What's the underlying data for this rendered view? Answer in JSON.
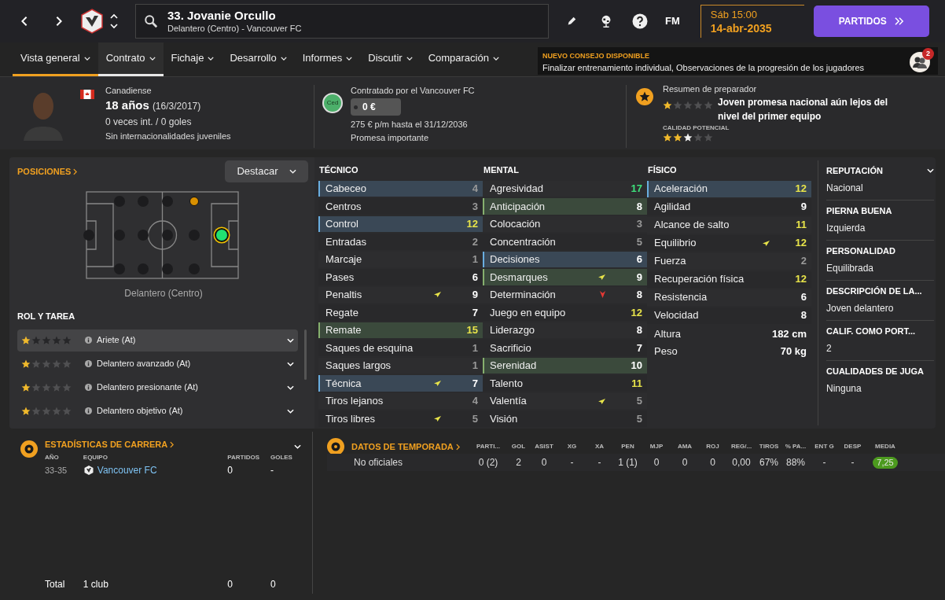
{
  "topbar": {
    "player_title": "33. Jovanie Orcullo",
    "player_subtitle": "Delantero (Centro) - Vancouver FC",
    "fm_label": "FM",
    "day_time": "Sáb 15:00",
    "date": "14-abr-2035",
    "continue_button": "PARTIDOS"
  },
  "tabs": [
    {
      "label": "Vista general",
      "selected": true,
      "hovered": false
    },
    {
      "label": "Contrato",
      "selected": false,
      "hovered": true
    },
    {
      "label": "Fichaje",
      "selected": false,
      "hovered": false
    },
    {
      "label": "Desarrollo",
      "selected": false,
      "hovered": false
    },
    {
      "label": "Informes",
      "selected": false,
      "hovered": false
    },
    {
      "label": "Discutir",
      "selected": false,
      "hovered": false
    },
    {
      "label": "Comparación",
      "selected": false,
      "hovered": false
    }
  ],
  "notification": {
    "title": "NUEVO CONSEJO DISPONIBLE",
    "text": "Finalizar entrenamiento individual, Observaciones de la progresión de los jugadores",
    "badge": "2"
  },
  "header": {
    "nationality": "Canadiense",
    "age": "18 años",
    "birth": "(16/3/2017)",
    "caps": "0 veces int. / 0 goles",
    "youth": "Sin internacionalidades juveniles",
    "contract_badge": "Ced",
    "contract_title": "Contratado por el Vancouver FC",
    "wage": "0 €",
    "wage_terms": "275 € p/m hasta el 31/12/2036",
    "status": "Promesa importante",
    "coach_title": "Resumen de preparador",
    "current": {
      "stars": 1
    },
    "coach_summary": "Joven promesa nacional aún lejos del nivel del primer equipo",
    "potential": {
      "label": "CALIDAD POTENCIAL",
      "stars": 2,
      "uncertain_next": true
    }
  },
  "positions": {
    "title": "POSICIONES",
    "highlight_button": "Destacar",
    "pitch": [
      [
        {
          "kind": "empty"
        }
      ],
      [
        {
          "kind": "empty"
        },
        {
          "kind": "empty"
        },
        {
          "kind": "empty"
        }
      ],
      [
        {
          "kind": "empty"
        },
        {
          "kind": "empty"
        },
        {
          "kind": "empty"
        }
      ],
      [
        {
          "kind": "empty"
        },
        {
          "kind": "empty"
        },
        {
          "kind": "empty"
        }
      ],
      [
        {
          "kind": "competent"
        },
        {
          "kind": "empty"
        },
        {
          "kind": "empty"
        }
      ],
      [
        {
          "kind": "natural"
        }
      ]
    ],
    "position_label": "Delantero (Centro)"
  },
  "roles": {
    "title": "ROL Y TAREA",
    "items": [
      {
        "name": "Ariete (At)",
        "stars": 1,
        "selected": true
      },
      {
        "name": "Delantero avanzado (At)",
        "stars": 1,
        "selected": false
      },
      {
        "name": "Delantero presionante (At)",
        "stars": 1,
        "selected": false
      },
      {
        "name": "Delantero objetivo (At)",
        "stars": 1,
        "selected": false
      }
    ]
  },
  "attributes": [
    {
      "title": "TÉCNICO",
      "items": [
        {
          "name": "Cabeceo",
          "value": "4",
          "kind": "key",
          "rising": false,
          "falling": false
        },
        {
          "name": "Centros",
          "value": "3",
          "kind": "plain",
          "rising": false,
          "falling": false
        },
        {
          "name": "Control",
          "value": "12",
          "kind": "key",
          "rising": false,
          "falling": false
        },
        {
          "name": "Entradas",
          "value": "2",
          "kind": "plain",
          "rising": false,
          "falling": false
        },
        {
          "name": "Marcaje",
          "value": "1",
          "kind": "plain",
          "rising": false,
          "falling": false
        },
        {
          "name": "Pases",
          "value": "6",
          "kind": "plain",
          "rising": false,
          "falling": false
        },
        {
          "name": "Penaltis",
          "value": "9",
          "kind": "plain",
          "rising": true,
          "falling": false
        },
        {
          "name": "Regate",
          "value": "7",
          "kind": "plain",
          "rising": false,
          "falling": false
        },
        {
          "name": "Remate",
          "value": "15",
          "kind": "preferred",
          "rising": false,
          "falling": false
        },
        {
          "name": "Saques de esquina",
          "value": "1",
          "kind": "plain",
          "rising": false,
          "falling": false
        },
        {
          "name": "Saques largos",
          "value": "1",
          "kind": "plain",
          "rising": false,
          "falling": false
        },
        {
          "name": "Técnica",
          "value": "7",
          "kind": "key",
          "rising": true,
          "falling": false
        },
        {
          "name": "Tiros lejanos",
          "value": "4",
          "kind": "plain",
          "rising": false,
          "falling": false
        },
        {
          "name": "Tiros libres",
          "value": "5",
          "kind": "plain",
          "rising": true,
          "falling": false
        }
      ]
    },
    {
      "title": "MENTAL",
      "items": [
        {
          "name": "Agresividad",
          "value": "17",
          "kind": "plain",
          "rising": false,
          "falling": false
        },
        {
          "name": "Anticipación",
          "value": "8",
          "kind": "preferred",
          "rising": false,
          "falling": false
        },
        {
          "name": "Colocación",
          "value": "3",
          "kind": "plain",
          "rising": false,
          "falling": false
        },
        {
          "name": "Concentración",
          "value": "5",
          "kind": "plain",
          "rising": false,
          "falling": false
        },
        {
          "name": "Decisiones",
          "value": "6",
          "kind": "key",
          "rising": false,
          "falling": false
        },
        {
          "name": "Desmarques",
          "value": "9",
          "kind": "preferred",
          "rising": true,
          "falling": false
        },
        {
          "name": "Determinación",
          "value": "8",
          "kind": "plain",
          "rising": false,
          "falling": true
        },
        {
          "name": "Juego en equipo",
          "value": "12",
          "kind": "plain",
          "rising": false,
          "falling": false
        },
        {
          "name": "Liderazgo",
          "value": "8",
          "kind": "plain",
          "rising": false,
          "falling": false
        },
        {
          "name": "Sacrificio",
          "value": "7",
          "kind": "plain",
          "rising": false,
          "falling": false
        },
        {
          "name": "Serenidad",
          "value": "10",
          "kind": "preferred",
          "rising": false,
          "falling": false
        },
        {
          "name": "Talento",
          "value": "11",
          "kind": "plain",
          "rising": false,
          "falling": false
        },
        {
          "name": "Valentía",
          "value": "5",
          "kind": "plain",
          "rising": true,
          "falling": false
        },
        {
          "name": "Visión",
          "value": "5",
          "kind": "plain",
          "rising": false,
          "falling": false
        }
      ]
    },
    {
      "title": "FÍSICO",
      "items": [
        {
          "name": "Aceleración",
          "value": "12",
          "kind": "key",
          "rising": false,
          "falling": false
        },
        {
          "name": "Agilidad",
          "value": "9",
          "kind": "plain",
          "rising": false,
          "falling": false
        },
        {
          "name": "Alcance de salto",
          "value": "11",
          "kind": "plain",
          "rising": false,
          "falling": false
        },
        {
          "name": "Equilibrio",
          "value": "12",
          "kind": "plain",
          "rising": true,
          "falling": false
        },
        {
          "name": "Fuerza",
          "value": "2",
          "kind": "plain",
          "rising": false,
          "falling": false
        },
        {
          "name": "Recuperación física",
          "value": "12",
          "kind": "plain",
          "rising": false,
          "falling": false
        },
        {
          "name": "Resistencia",
          "value": "6",
          "kind": "plain",
          "rising": false,
          "falling": false
        },
        {
          "name": "Velocidad",
          "value": "8",
          "kind": "plain",
          "rising": false,
          "falling": false
        }
      ],
      "body": [
        {
          "label": "Altura",
          "value": "182 cm"
        },
        {
          "label": "Peso",
          "value": "70 kg"
        }
      ]
    }
  ],
  "info": [
    {
      "label": "REPUTACIÓN",
      "value": "Nacional",
      "dropdown": true
    },
    {
      "label": "PIERNA BUENA",
      "value": "Izquierda",
      "dropdown": false
    },
    {
      "label": "PERSONALIDAD",
      "value": "Equilibrada",
      "dropdown": false
    },
    {
      "label": "DESCRIPCIÓN DE LA...",
      "value": "Joven delantero",
      "dropdown": false
    },
    {
      "label": "CALIF. COMO PORT...",
      "value": "2",
      "dropdown": false
    },
    {
      "label": "CUALIDADES DE JUGA",
      "value": "Ninguna",
      "dropdown": false
    }
  ],
  "career": {
    "title": "ESTADÍSTICAS DE CARRERA",
    "columns": [
      "AÑO",
      "EQUIPO",
      "PARTIDOS",
      "GOLES"
    ],
    "rows": [
      {
        "year": "33-35",
        "team": "Vancouver FC",
        "apps": "0",
        "goals": "-"
      }
    ],
    "total": {
      "label": "Total",
      "clubs": "1 club",
      "apps": "0",
      "goals": "0"
    }
  },
  "season": {
    "title": "DATOS DE TEMPORADA",
    "columns": [
      "PARTI...",
      "GOL",
      "ASIST",
      "XG",
      "XA",
      "PEN",
      "MJP",
      "AMA",
      "ROJ",
      "REG/...",
      "TIROS",
      "% PA...",
      "ENT G",
      "DESP",
      "MEDIA"
    ],
    "rows": [
      {
        "competition": "No oficiales",
        "values": [
          "0 (2)",
          "2",
          "0",
          "-",
          "-",
          "1 (1)",
          "0",
          "0",
          "0",
          "0,00",
          "67%",
          "88%",
          "-",
          "-"
        ],
        "rating": "7,25"
      }
    ]
  }
}
